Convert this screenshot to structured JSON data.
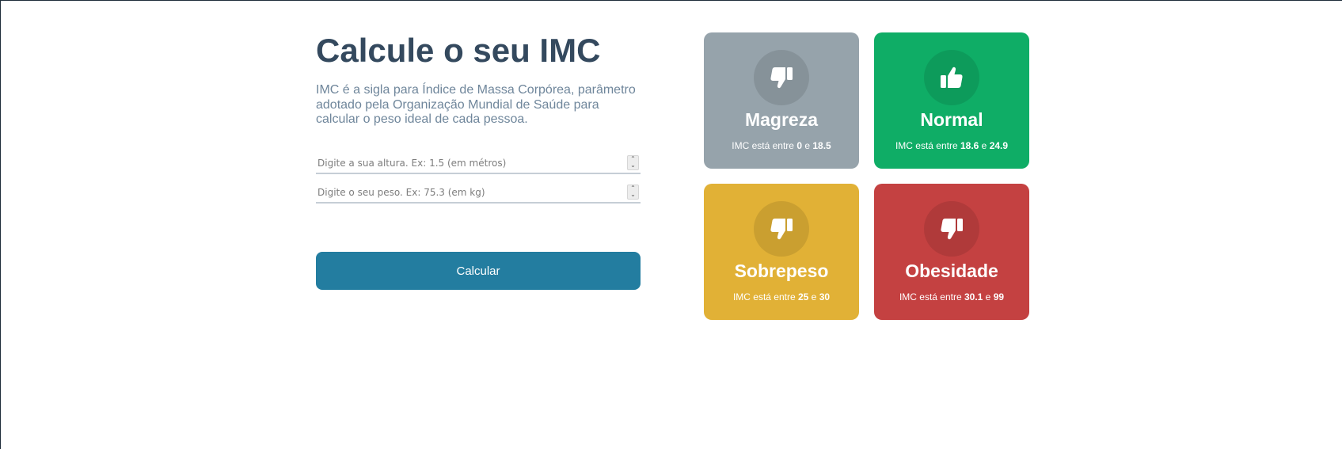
{
  "header": {
    "title": "Calcule o seu IMC",
    "description": "IMC é a sigla para Índice de Massa Corpórea, parâmetro adotado pela Organização Mundial de Saúde para calcular o peso ideal de cada pessoa."
  },
  "form": {
    "height_placeholder": "Digite a sua altura. Ex: 1.5 (em métros)",
    "height_value": "",
    "weight_placeholder": "Digite o seu peso. Ex: 75.3 (em kg)",
    "weight_value": "",
    "spinner_up": "⌃",
    "spinner_down": "⌄",
    "calc_label": "Calcular"
  },
  "cards": [
    {
      "title": "Magreza",
      "info_prefix": "IMC está entre ",
      "min": "0",
      "connector": " e ",
      "max": "18.5",
      "color": "#96a3ab",
      "icon": "thumbs-down-icon"
    },
    {
      "title": "Normal",
      "info_prefix": "IMC está entre ",
      "min": "18.6",
      "connector": " e ",
      "max": "24.9",
      "color": "#0fad66",
      "icon": "thumbs-up-icon"
    },
    {
      "title": "Sobrepeso",
      "info_prefix": "IMC está entre ",
      "min": "25",
      "connector": " e ",
      "max": "30",
      "color": "#e1b136",
      "icon": "thumbs-down-icon"
    },
    {
      "title": "Obesidade",
      "info_prefix": "IMC está entre ",
      "min": "30.1",
      "connector": " e ",
      "max": "99",
      "color": "#c44141",
      "icon": "thumbs-down-icon"
    }
  ]
}
